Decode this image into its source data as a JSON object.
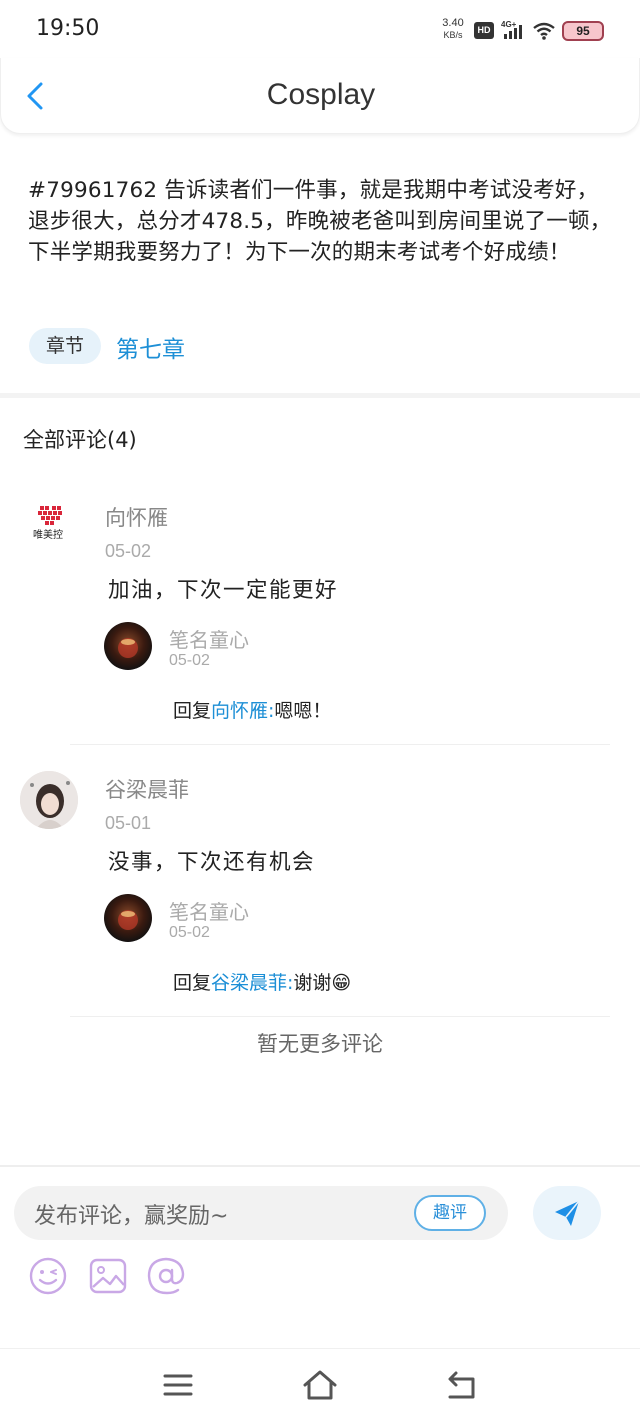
{
  "status_bar": {
    "time": "19:50",
    "net_speed_value": "3.40",
    "net_speed_unit": "KB/s",
    "hd_label": "HD",
    "network_label": "4G+",
    "battery": "95",
    "battery_color": "#f7c6cc"
  },
  "header": {
    "title": "Cosplay",
    "back_icon": "chevron-left-icon",
    "accent": "#2196f3"
  },
  "post": {
    "text": "#79961762 告诉读者们一件事，就是我期中考试没考好，退步很大，总分才478.5，昨晚被老爸叫到房间里说了一顿，下半学期我要努力了！为下一次的期末考试考个好成绩！",
    "chapter_tag": "章节",
    "chapter_name": "第七章"
  },
  "comments_section": {
    "title": "全部评论(4)",
    "comments": [
      {
        "avatar_label": "唯美控",
        "name": "向怀雁",
        "date": "05-02",
        "text": "加油，下次一定能更好",
        "reply": {
          "name": "笔名童心",
          "date": "05-02",
          "prefix": "回复",
          "target": "向怀雁:",
          "text": "嗯嗯！"
        }
      },
      {
        "name": "谷梁晨菲",
        "date": "05-01",
        "text": "没事，下次还有机会",
        "reply": {
          "name": "笔名童心",
          "date": "05-02",
          "prefix": "回复",
          "target": "谷梁晨菲:",
          "text": "谢谢😁"
        }
      }
    ],
    "footer": "暂无更多评论"
  },
  "composer": {
    "placeholder": "发布评论，赢奖励~",
    "quping_label": "趣评",
    "send_icon": "send-icon",
    "tools": [
      "emoji-icon",
      "image-icon",
      "mention-icon"
    ],
    "tool_color": "#c9a8e6"
  },
  "nav_bar": {
    "buttons": [
      "menu-icon",
      "home-icon",
      "back-icon"
    ]
  },
  "link_color": "#1d8fd6"
}
